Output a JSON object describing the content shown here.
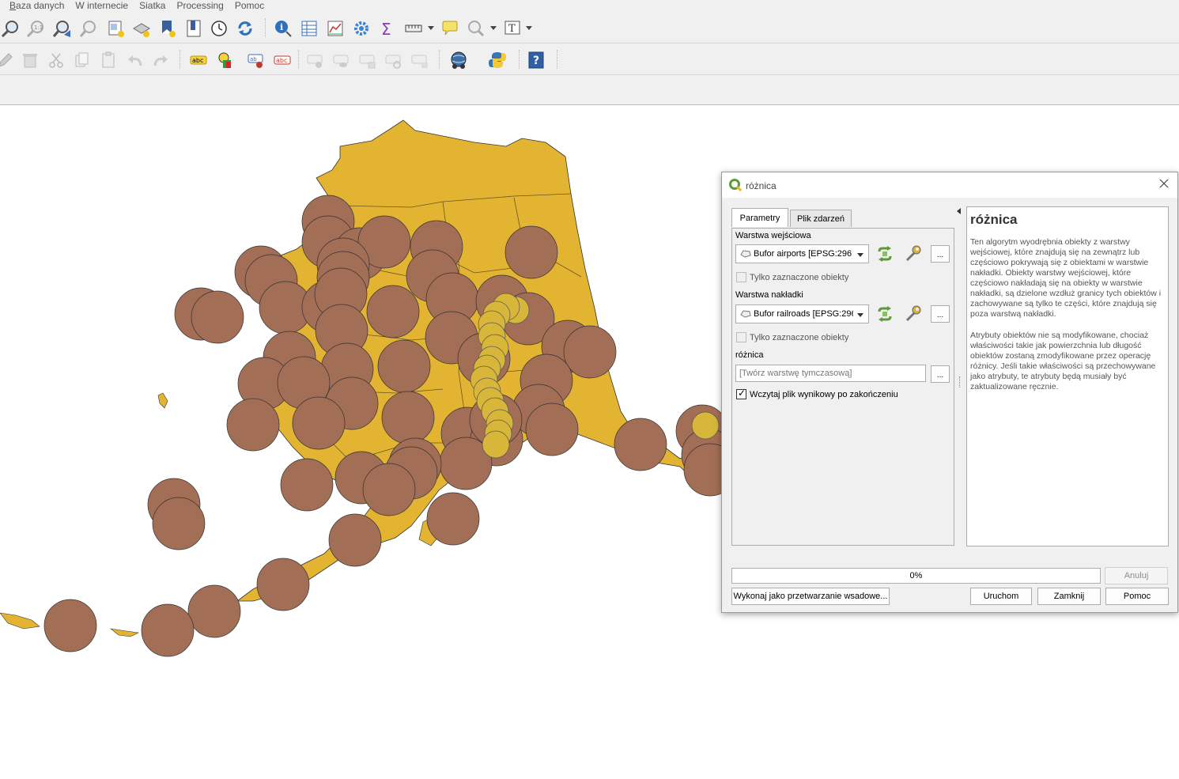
{
  "menubar": {
    "items": [
      "Baza danych",
      "W internecie",
      "Siatka",
      "Processing",
      "Pomoc"
    ]
  },
  "toolbar_icons": {
    "row1": [
      "zoom-icon",
      "zoom-native-icon",
      "zoom-layer-icon",
      "zoom-last-icon",
      "new-bookmark-icon",
      "show-bookmarks-icon",
      "map-tips-icon",
      "spatial-bookmark-icon",
      "temporal-controller-icon",
      "refresh-icon",
      "identify-icon",
      "attribute-table-icon",
      "statistics-icon",
      "settings-gear-icon",
      "sum-icon",
      "measure-icon",
      "annotation-icon",
      "select-icon",
      "text-annotation-icon"
    ],
    "row2": [
      "edit-icon",
      "delete-icon",
      "cut-icon",
      "copy-icon",
      "paste-icon",
      "undo-icon",
      "redo-icon",
      "label-abc-icon",
      "label-color-icon",
      "label-pin-icon",
      "label-delete-icon",
      "label-move-icon",
      "label-show-icon",
      "label-rotate-icon",
      "label-change-icon",
      "label-lock-icon",
      "globe-icon",
      "python-icon",
      "help-icon"
    ]
  },
  "dialog": {
    "title": "różnica",
    "tabs": [
      "Parametry",
      "Plik zdarzeń"
    ],
    "input_layer_label": "Warstwa wejściowa",
    "input_layer_value": "Bufor airports [EPSG:296⁠",
    "selected_only_1": "Tylko zaznaczone obiekty",
    "overlay_layer_label": "Warstwa nakładki",
    "overlay_layer_value": "Bufor railroads [EPSG:296",
    "selected_only_2": "Tylko zaznaczone obiekty",
    "output_label": "różnica",
    "output_placeholder": "[Twórz warstwę tymczasową]",
    "load_result_label": "Wczytaj plik wynikowy po zakończeniu",
    "load_result_checked": true,
    "dots_label": "...",
    "help_title": "różnica",
    "help_p1": "Ten algorytm wyodrębnia obiekty z warstwy wejściowej, które znajdują się na zewnątrz lub częściowo pokrywają się z obiektami w warstwie nakładki. Obiekty warstwy wejściowej, które częściowo nakładają się na obiekty w warstwie nakładki, są dzielone wzdłuż granicy tych obiektów i zachowywane są tylko te części, które znajdują się poza warstwą nakładki.",
    "help_p2": "Atrybuty obiektów nie są modyfikowane, chociaż właściwości takie jak powierzchnia lub długość obiektów zostaną zmodyfikowane przez operację różnicy. Jeśli takie właściwości są przechowywane jako atrybuty, te atrybuty będą musiały być zaktualizowane ręcznie.",
    "progress_text": "0%",
    "progress_value": 0,
    "cancel_label": "Anuluj",
    "batch_label": "Wykonaj jako przetwarzanie wsadowe...",
    "run_label": "Uruchom",
    "close_label": "Zamknij",
    "help_label": "Pomoc"
  },
  "colors": {
    "land_fill": "#e3b432",
    "buffer_airports": "#a26e55",
    "buffer_railroads": "#d7b63a",
    "qgis_green": "#5d9b38"
  }
}
